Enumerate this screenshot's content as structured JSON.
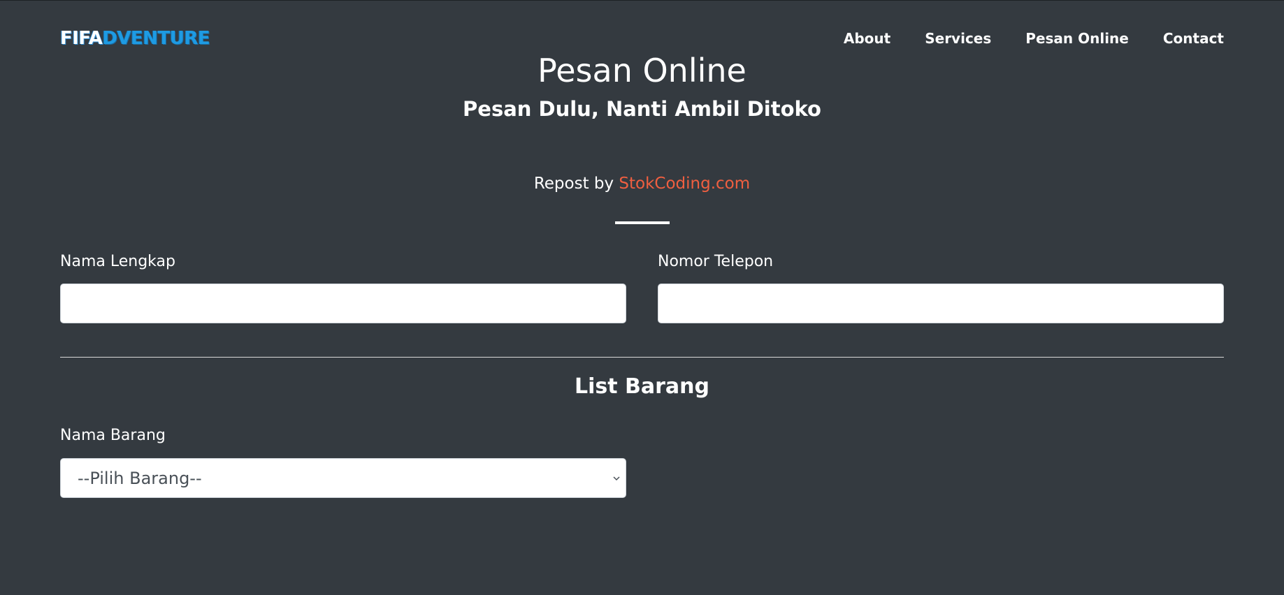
{
  "navbar": {
    "brand_part1": "FIFA",
    "brand_part2": "DVENTURE",
    "links": [
      "About",
      "Services",
      "Pesan Online",
      "Contact"
    ]
  },
  "header": {
    "title": "Pesan Online",
    "subtitle": "Pesan Dulu, Nanti Ambil Ditoko",
    "repost_prefix": "Repost by",
    "repost_link": "StokCoding.com"
  },
  "form": {
    "name_label": "Nama Lengkap",
    "name_value": "",
    "phone_label": "Nomor Telepon",
    "phone_value": "",
    "section_title": "List Barang",
    "item_label": "Nama Barang",
    "item_selected": "--Pilih Barang--"
  },
  "icons": {
    "select_chevron": "chevron-down-icon"
  },
  "colors": {
    "background": "#343a40",
    "brand_accent": "#1e9be3",
    "link_accent": "#f05f40"
  }
}
